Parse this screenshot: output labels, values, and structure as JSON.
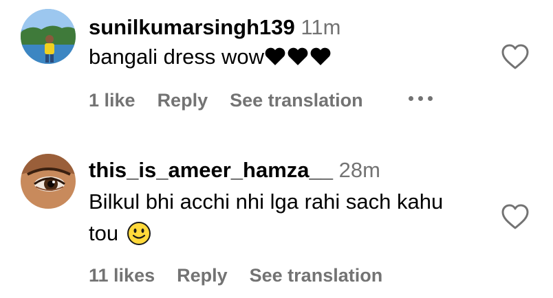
{
  "comments": [
    {
      "username": "sunilkumarsingh139",
      "time": "11m",
      "text": "bangali dress wow",
      "reaction_icons": [
        "black-heart-icon",
        "black-heart-icon",
        "black-heart-icon"
      ],
      "likes": "1 like",
      "reply_label": "Reply",
      "translate_label": "See translation",
      "more_icon": "more-options-icon",
      "like_icon": "heart-outline-icon"
    },
    {
      "username": "this_is_ameer_hamza__",
      "time": "28m",
      "text_line1": "Bilkul bhi acchi nhi lga rahi sach kahu",
      "text_line2": "tou",
      "emoji_icon": "slightly-smiling-face-icon",
      "likes": "11 likes",
      "reply_label": "Reply",
      "translate_label": "See translation",
      "like_icon": "heart-outline-icon"
    }
  ],
  "colors": {
    "secondary_text": "#737373",
    "primary_text": "#000000",
    "background": "#ffffff"
  }
}
